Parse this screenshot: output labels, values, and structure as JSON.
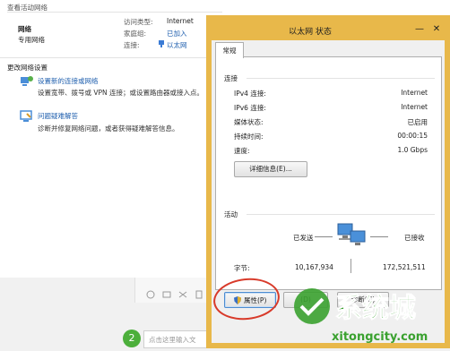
{
  "background": {
    "title": "查看活动网络",
    "network_name": "网络",
    "network_type": "专用网络",
    "access_type_label": "访问类型:",
    "access_type_value": "Internet",
    "homegroup_label": "家庭组:",
    "homegroup_value": "已加入",
    "connections_label": "连接:",
    "connections_value": "以太网",
    "change_settings_title": "更改网络设置",
    "setup_link": "设置新的连接或网络",
    "setup_desc": "设置宽带、拨号或 VPN 连接；或设置路由器或接入点。",
    "troubleshoot_link": "问题疑难解答",
    "troubleshoot_desc": "诊断并修复网络问题，或者获得疑难解答信息。",
    "chat_badge": "2",
    "chat_placeholder": "点击这里输入文"
  },
  "dialog": {
    "title": "以太网 状态",
    "tab": "常规",
    "connection_group": "连接",
    "rows": [
      {
        "label": "IPv4 连接:",
        "value": "Internet"
      },
      {
        "label": "IPv6 连接:",
        "value": "Internet"
      },
      {
        "label": "媒体状态:",
        "value": "已启用"
      },
      {
        "label": "持续时间:",
        "value": "00:00:15"
      },
      {
        "label": "速度:",
        "value": "1.0 Gbps"
      }
    ],
    "details_button": "详细信息(E)...",
    "activity_group": "活动",
    "sent_label": "已发送",
    "received_label": "已接收",
    "bytes_label": "字节:",
    "bytes_sent": "10,167,934",
    "bytes_received": "172,521,511",
    "properties_button": "属性(P)",
    "disable_button": "(D)",
    "diagnose_button": "诊断(G)",
    "close_glyph": "✕",
    "minimize_glyph": "—"
  },
  "watermark": {
    "brand": "系统城",
    "url": "xitongcity.com"
  },
  "colors": {
    "dialog_frame": "#e8b84a",
    "link": "#1f5fae",
    "annotation_red": "#d83a2a",
    "watermark_green": "#3aa12f"
  }
}
